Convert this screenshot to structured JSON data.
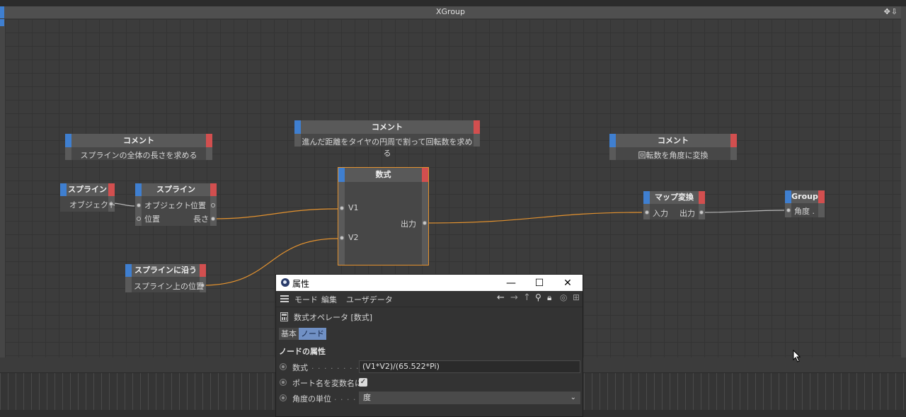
{
  "window": {
    "title": "XGroup",
    "title_icons": "✥⇩"
  },
  "nodes": {
    "comment1": {
      "title": "コメント",
      "text": "スプラインの全体の長さを求める"
    },
    "comment2": {
      "title": "コメント",
      "text": "進んだ距離をタイヤの円周で割って回転数を求める"
    },
    "comment3": {
      "title": "コメント",
      "text": "回転数を角度に変換"
    },
    "spline_obj": {
      "title": "スプライン",
      "out": "オブジェクト"
    },
    "spline": {
      "title": "スプライン",
      "in1": "オブジェクト",
      "in2": "位置",
      "out1": "位置",
      "out2": "長さ"
    },
    "formula": {
      "title": "数式",
      "in1": "V1",
      "in2": "V2",
      "out": "出力"
    },
    "along": {
      "title": "スプラインに沿う",
      "out": "スプライン上の位置"
    },
    "rangemap": {
      "title": "マップ変換",
      "in": "入力",
      "out": "出力"
    },
    "group": {
      "title": "Group",
      "in": "角度 ."
    }
  },
  "attributes": {
    "title": "属性",
    "controls": {
      "minimize": "—",
      "maximize": "☐",
      "close": "✕"
    },
    "menu": {
      "mode": "モード",
      "edit": "編集",
      "userdata": "ユーザデータ"
    },
    "toolbar_icons": [
      "arrow-left-icon",
      "arrow-right-icon",
      "arrow-up-icon",
      "search-icon",
      "lock-icon",
      "target-icon",
      "new-panel-icon"
    ],
    "object": "数式オペレータ [数式]",
    "tabs": {
      "basic": "基本",
      "node": "ノード"
    },
    "section": "ノードの属性",
    "props": {
      "formula_label": "数式",
      "formula_dots": ". . . . . . . . . .",
      "formula_value": "(V1*V2)/(65.522*Pi)",
      "portname_label": "ポート名を変数名に",
      "portname_checked": true,
      "angle_label": "角度の単位",
      "angle_dots": ". . . . .",
      "angle_value": "度"
    }
  },
  "colors": {
    "wire": "#e3922f",
    "wire_grey": "#b8b8b8",
    "cap_blue": "#3f7fd0",
    "cap_red": "#d24f4f",
    "formula_border": "#e3922f"
  }
}
